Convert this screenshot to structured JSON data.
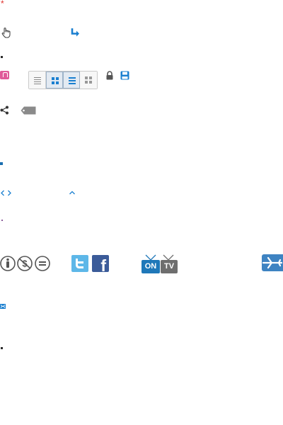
{
  "markers": {
    "asterisk": "*"
  },
  "tv": {
    "on_label": "ON",
    "tv_label": "TV"
  },
  "social": {
    "facebook_glyph": "f"
  },
  "colors": {
    "blue_accent": "#1a7fd0",
    "pink": "#e05a9a",
    "twitter": "#5db7e8",
    "facebook": "#3b5b99",
    "tv_on": "#1f78b9",
    "tv_gray": "#6e6e6e",
    "plane": "#3e83c2"
  },
  "icons": [
    "hand-pointer-icon",
    "turn-arrow-icon",
    "pink-badge-icon",
    "list-view-icon",
    "grid-view-icon",
    "detail-view-icon",
    "tile-view-icon",
    "lock-icon",
    "save-icon",
    "share-icon",
    "tag-icon",
    "chevron-left-icon",
    "chevron-right-icon",
    "chevron-up-icon",
    "cc-by-icon",
    "cc-nc-icon",
    "cc-nd-icon",
    "twitter-icon",
    "facebook-icon",
    "on-tv-icon",
    "tv-icon",
    "plane-icon",
    "email-icon"
  ]
}
